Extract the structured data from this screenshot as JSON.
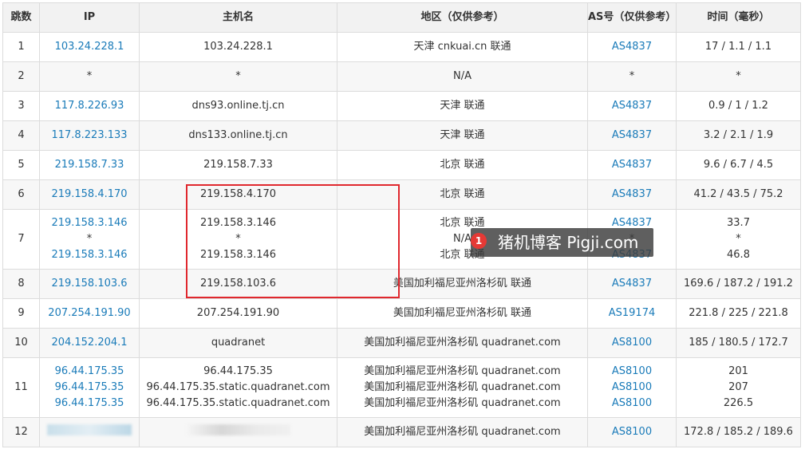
{
  "headers": {
    "hop": "跳数",
    "ip": "IP",
    "host": "主机名",
    "region": "地区（仅供参考）",
    "as": "AS号（仅供参考）",
    "time": "时间（毫秒）"
  },
  "rows": [
    {
      "hop": "1",
      "ip": [
        "103.24.228.1"
      ],
      "host": [
        "103.24.228.1"
      ],
      "region": [
        "天津 cnkuai.cn 联通"
      ],
      "as": [
        "AS4837"
      ],
      "time": [
        "17 / 1.1 / 1.1"
      ]
    },
    {
      "hop": "2",
      "ip": [
        "*"
      ],
      "host": [
        "*"
      ],
      "region": [
        "N/A"
      ],
      "as": [
        "*"
      ],
      "time": [
        "*"
      ]
    },
    {
      "hop": "3",
      "ip": [
        "117.8.226.93"
      ],
      "host": [
        "dns93.online.tj.cn"
      ],
      "region": [
        "天津 联通"
      ],
      "as": [
        "AS4837"
      ],
      "time": [
        "0.9 / 1 / 1.2"
      ]
    },
    {
      "hop": "4",
      "ip": [
        "117.8.223.133"
      ],
      "host": [
        "dns133.online.tj.cn"
      ],
      "region": [
        "天津 联通"
      ],
      "as": [
        "AS4837"
      ],
      "time": [
        "3.2 / 2.1 / 1.9"
      ]
    },
    {
      "hop": "5",
      "ip": [
        "219.158.7.33"
      ],
      "host": [
        "219.158.7.33"
      ],
      "region": [
        "北京 联通"
      ],
      "as": [
        "AS4837"
      ],
      "time": [
        "9.6 / 6.7 / 4.5"
      ]
    },
    {
      "hop": "6",
      "ip": [
        "219.158.4.170"
      ],
      "host": [
        "219.158.4.170"
      ],
      "region": [
        "北京 联通"
      ],
      "as": [
        "AS4837"
      ],
      "time": [
        "41.2 / 43.5 / 75.2"
      ]
    },
    {
      "hop": "7",
      "ip": [
        "219.158.3.146",
        "*",
        "219.158.3.146"
      ],
      "host": [
        "219.158.3.146",
        "*",
        "219.158.3.146"
      ],
      "region": [
        "北京 联通",
        "N/A",
        "北京 联通"
      ],
      "as": [
        "AS4837",
        "*",
        "AS4837"
      ],
      "time": [
        "33.7",
        "*",
        "46.8"
      ]
    },
    {
      "hop": "8",
      "ip": [
        "219.158.103.6"
      ],
      "host": [
        "219.158.103.6"
      ],
      "region": [
        "美国加利福尼亚州洛杉矶 联通"
      ],
      "as": [
        "AS4837"
      ],
      "time": [
        "169.6 / 187.2 / 191.2"
      ]
    },
    {
      "hop": "9",
      "ip": [
        "207.254.191.90"
      ],
      "host": [
        "207.254.191.90"
      ],
      "region": [
        "美国加利福尼亚州洛杉矶 联通"
      ],
      "as": [
        "AS19174"
      ],
      "time": [
        "221.8 / 225 / 221.8"
      ]
    },
    {
      "hop": "10",
      "ip": [
        "204.152.204.1"
      ],
      "host": [
        "quadranet"
      ],
      "region": [
        "美国加利福尼亚州洛杉矶 quadranet.com"
      ],
      "as": [
        "AS8100"
      ],
      "time": [
        "185 / 180.5 / 172.7"
      ]
    },
    {
      "hop": "11",
      "ip": [
        "96.44.175.35",
        "96.44.175.35",
        "96.44.175.35"
      ],
      "host": [
        "96.44.175.35",
        "96.44.175.35.static.quadranet.com",
        "96.44.175.35.static.quadranet.com"
      ],
      "region": [
        "美国加利福尼亚州洛杉矶 quadranet.com",
        "美国加利福尼亚州洛杉矶 quadranet.com",
        "美国加利福尼亚州洛杉矶 quadranet.com"
      ],
      "as": [
        "AS8100",
        "AS8100",
        "AS8100"
      ],
      "time": [
        "201",
        "207",
        "226.5"
      ]
    },
    {
      "hop": "12",
      "ip": [],
      "host": [],
      "region": [
        "美国加利福尼亚州洛杉矶 quadranet.com"
      ],
      "as": [
        "AS8100"
      ],
      "time": [
        "172.8 / 185.2 / 189.6"
      ]
    }
  ],
  "watermark": {
    "badge": "1",
    "text": "猪机博客 Pigji.com"
  },
  "colors": {
    "link": "#1a7bb9",
    "highlight_border": "#e0282e",
    "header_bg": "#f2f2f2"
  }
}
